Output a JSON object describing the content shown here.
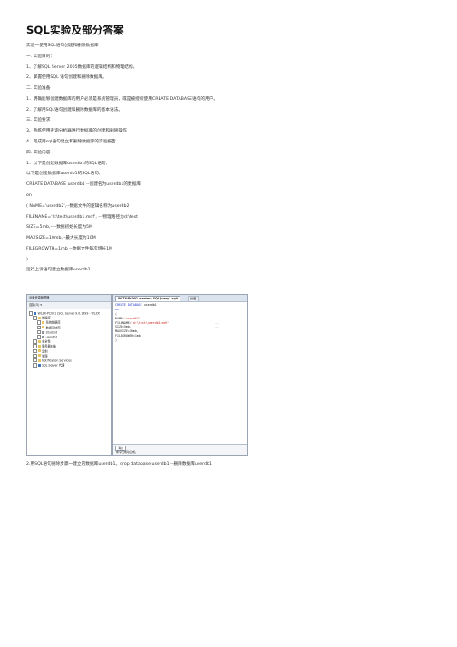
{
  "document": {
    "title": "SQL实验及部分答案",
    "lines": [
      "实验一使用SQL语句创建和删除数据库",
      "一. 实验目的：",
      "1、了解SQL Server 2005数据库的逻辑结构和物理结构。",
      "2、掌握使用SQL 语句创建和删除数据库。",
      "二. 实验准备",
      "1．明确能够创建数据库的用户必须是系统管理员，或是被授权使用CREATE DATABASE语句的用户。",
      "2．了解用SQL语句创建和删除数据库的基本语法。",
      "三. 实验要求",
      "3、熟练使用查询分析器进行数据库的创建和删除操作",
      "4、完成用sql语句建立和删除数据库的实验报告",
      "四. 实验内容",
      "1．以下是创建数据库userdb1的SQL语句,",
      "以下是创建数据库userdb1的SQL语句,",
      "CREATE DATABASE userdb1 --创建名为userdb1的数据库",
      "on",
      "( NAME='userdb2',--数据文件的逻辑名称为userdb2",
      "FILENAME='d:\\test\\userdb1.mdf', ---物理路径为d:\\test",
      "SIZE=5mb,----数据初始长度为5M",
      "MAXSIZE=10mb,--最大长度为10M",
      "FILEGROWTH=1mb --数据文件每次增长1M",
      ")",
      "运行上诉语句建立数据库userdb1."
    ],
    "after_text": "2.用SQL语句删除步骤一建立的数据库userdb1。drop database userdb1 --删除数据库userdb1"
  },
  "screenshot": {
    "object_explorer": {
      "header": "对象资源管理器",
      "toolbar": "连接(O) ▾",
      "tree": [
        {
          "label": "WLZX-PC001 (SQL Server 9.0.1399 - WLZX",
          "depth": 0,
          "icon": "server-icon"
        },
        {
          "label": "数据库",
          "depth": 1,
          "icon": "folder-icon"
        },
        {
          "label": "系统数据库",
          "depth": 2,
          "icon": "folder-icon"
        },
        {
          "label": "数据库快照",
          "depth": 2,
          "icon": "folder-icon"
        },
        {
          "label": "Student",
          "depth": 2,
          "icon": "database-icon"
        },
        {
          "label": "userdb1",
          "depth": 2,
          "icon": "database-icon"
        },
        {
          "label": "安全性",
          "depth": 1,
          "icon": "folder-icon"
        },
        {
          "label": "服务器对象",
          "depth": 1,
          "icon": "folder-icon"
        },
        {
          "label": "复制",
          "depth": 1,
          "icon": "folder-icon"
        },
        {
          "label": "管理",
          "depth": 1,
          "icon": "folder-icon"
        },
        {
          "label": "Notification Services",
          "depth": 1,
          "icon": "folder-icon"
        },
        {
          "label": "SQL Server 代理",
          "depth": 1,
          "icon": "agent-icon"
        }
      ]
    },
    "editor": {
      "tab_active": "WLZX-PC001.master - SQLQuery1.sql*",
      "tab_other": "摘要",
      "code": [
        {
          "parts": [
            {
              "t": "CREATE DATABASE ",
              "c": "kw"
            },
            {
              "t": "userdb1",
              "c": "pl"
            }
          ]
        },
        {
          "parts": [
            {
              "t": "on",
              "c": "kw"
            }
          ]
        },
        {
          "parts": [
            {
              "t": "(",
              "c": "pl"
            }
          ]
        },
        {
          "parts": [
            {
              "t": "  NAME=",
              "c": "pl"
            },
            {
              "t": "'userdb2'",
              "c": "str"
            },
            {
              "t": ",",
              "c": "pl"
            }
          ],
          "comment": "--"
        },
        {
          "parts": [
            {
              "t": "  FILENAME=",
              "c": "pl"
            },
            {
              "t": "'d:\\test\\userdb1.mdf'",
              "c": "str"
            },
            {
              "t": ",",
              "c": "pl"
            }
          ],
          "comment": "--"
        },
        {
          "parts": [
            {
              "t": "  SIZE=5mb,",
              "c": "pl"
            }
          ],
          "comment": "--"
        },
        {
          "parts": [
            {
              "t": "  MAXSIZE=10mb,",
              "c": "pl"
            }
          ]
        },
        {
          "parts": [
            {
              "t": "  FILEGROWTH=1mb",
              "c": "pl"
            }
          ]
        },
        {
          "parts": [
            {
              "t": ")",
              "c": "pl"
            }
          ]
        }
      ],
      "results_tab": "消息",
      "results_message": "命令已成功完成。"
    }
  },
  "colors": {
    "keyword": "#1a32c8",
    "string": "#c8201a",
    "comment": "#2f8a2f",
    "folder": "#e8c25a",
    "database": "#8a8f98",
    "server": "#3a73c4"
  }
}
